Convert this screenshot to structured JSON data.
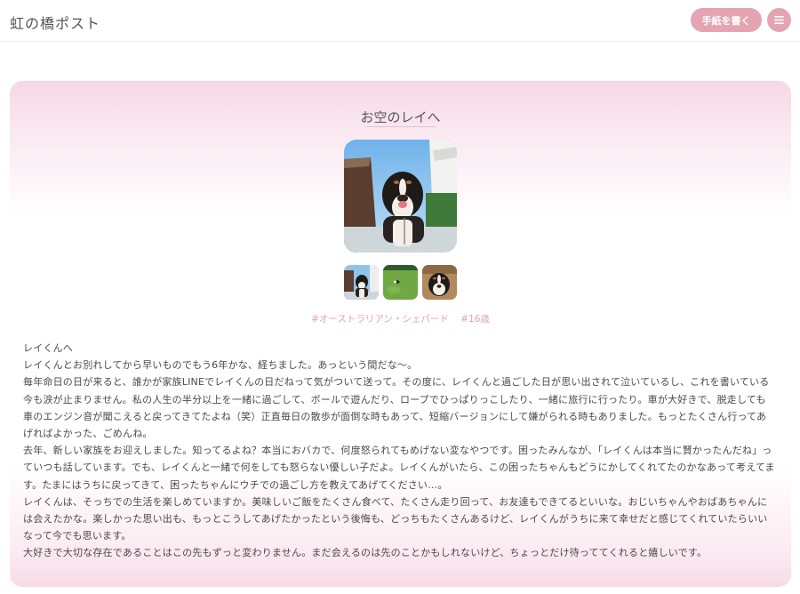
{
  "header": {
    "logo": "虹の橋ポスト",
    "write_button": "手紙を書く",
    "menu_icon": "hamburger-icon"
  },
  "letter": {
    "title": "お空のレイへ",
    "tags": [
      "#オーストラリアン・シェパード",
      "#16歳"
    ],
    "paragraphs": [
      "レイくんへ",
      "レイくんとお別れしてから早いものでもう6年かな、経ちました。あっという間だな〜。",
      "毎年命日の日が来ると、誰かが家族LINEでレイくんの日だねって気がついて送って。その度に、レイくんと過ごした日が思い出されて泣いているし、これを書いている今も涙が止まりません。私の人生の半分以上を一緒に過ごして、ボールで遊んだり、ロープでひっぱりっこしたり、一緒に旅行に行ったり。車が大好きで、脱走しても車のエンジン音が聞こえると戻ってきてたよね（笑）正直毎日の散歩が面倒な時もあって、短縮バージョンにして嫌がられる時もありました。もっとたくさん行ってあげればよかった、ごめんね。",
      "去年、新しい家族をお迎えしました。知ってるよね？本当におバカで、何度怒られてもめげない変なやつです。困ったみんなが、「レイくんは本当に賢かったんだね」っていつも話しています。でも、レイくんと一緒で何をしても怒らない優しい子だよ。レイくんがいたら、この困ったちゃんもどうにかしてくれてたのかなあって考えてます。たまにはうちに戻ってきて、困ったちゃんにウチでの過ごし方を教えてあげてください…。",
      "レイくんは、そっちでの生活を楽しめていますか。美味しいご飯をたくさん食べて、たくさん走り回って、お友達もできてるといいな。おじいちゃんやおばあちゃんには会えたかな。楽しかった思い出も、もっとこうしてあげたかったという後悔も、どっちもたくさんあるけど、レイくんがうちに来て幸せだと感じてくれていたらいいなって今でも思います。",
      "大好きで大切な存在であることはこの先もずっと変わりません。まだ会えるのは先のことかもしれないけど、ちょっとだけ待っててくれると嬉しいです。"
    ]
  },
  "colors": {
    "accent": "#e4a4b2",
    "tag": "#e0a3b3",
    "card_top": "#f6d8e6",
    "text": "#4a4a4a"
  }
}
